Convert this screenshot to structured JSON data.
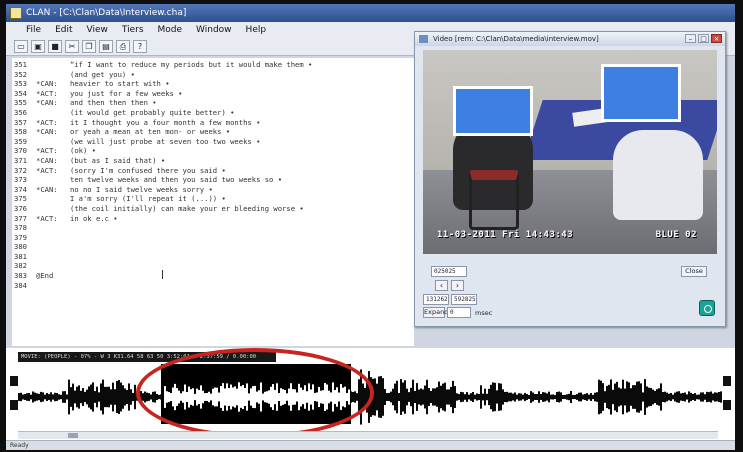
{
  "window": {
    "title": "CLAN - [C:\\Clan\\Data\\Interview.cha]"
  },
  "menu": [
    "File",
    "Edit",
    "View",
    "Tiers",
    "Mode",
    "Window",
    "Help"
  ],
  "toolbar_buttons": [
    "new",
    "open",
    "save",
    "cut",
    "copy",
    "paste",
    "print",
    "help"
  ],
  "transcript": [
    {
      "num": "351",
      "speaker": "",
      "text": "“if I want to reduce my periods but it would make them •"
    },
    {
      "num": "352",
      "speaker": "",
      "text": "(and get you) •"
    },
    {
      "num": "353",
      "speaker": "*CAN:",
      "text": "heavier to start with •"
    },
    {
      "num": "354",
      "speaker": "*ACT:",
      "text": "you just for a few weeks •"
    },
    {
      "num": "355",
      "speaker": "*CAN:",
      "text": "and then then then •"
    },
    {
      "num": "356",
      "speaker": "",
      "text": "(it would get probably quite better) •"
    },
    {
      "num": "357",
      "speaker": "*ACT:",
      "text": "it I thought you a four month a few months •"
    },
    {
      "num": "358",
      "speaker": "*CAN:",
      "text": "or yeah a mean at ten mon- or weeks •"
    },
    {
      "num": "359",
      "speaker": "",
      "text": "(we will just probe at seven too two weeks •"
    },
    {
      "num": "370",
      "speaker": "*ACT:",
      "text": "(ok) •"
    },
    {
      "num": "371",
      "speaker": "*CAN:",
      "text": "(but as I said that) •"
    },
    {
      "num": "372",
      "speaker": "*ACT:",
      "text": "(sorry I'm confused there you said •"
    },
    {
      "num": "373",
      "speaker": "",
      "text": "ten twelve weeks and then you said two weeks so •"
    },
    {
      "num": "374",
      "speaker": "*CAN:",
      "text": "no no I said twelve weeks sorry •"
    },
    {
      "num": "375",
      "speaker": "",
      "text": "I a'm sorry (I'll repeat it (...)) •"
    },
    {
      "num": "376",
      "speaker": "",
      "text": "(the coil initially) can make your er bleeding worse •"
    },
    {
      "num": "377",
      "speaker": "*ACT:",
      "text": "in ok e.c •"
    },
    {
      "num": "378",
      "speaker": "",
      "text": ""
    },
    {
      "num": "379",
      "speaker": "",
      "text": ""
    },
    {
      "num": "380",
      "speaker": "",
      "text": ""
    },
    {
      "num": "381",
      "speaker": "",
      "text": ""
    },
    {
      "num": "382",
      "speaker": "",
      "text": ""
    },
    {
      "num": "383",
      "speaker": "@End",
      "text": ""
    },
    {
      "num": "384",
      "speaker": "",
      "text": ""
    }
  ],
  "video_window": {
    "title": "Video [rem: C:\\Clan\\Data\\media\\interview.mov]",
    "timestamp": "11-03-2011 Fri 14:43:43",
    "camera": "BLUE 02",
    "time_field": "025025",
    "start_field": "131262",
    "end_field": "592825",
    "close_label": "Close",
    "expand_label": "Expand",
    "expand_value": "0",
    "unit_label": "msec",
    "colors": {
      "redaction": "#3e7fe2",
      "table": "#3b4aa0"
    }
  },
  "wave_panel": {
    "header_text": "MOVIE: (PEOPLE) - 07% - W 3 K31.64 58 63 50 3:52:01 / 2:37:59 / 0.00:00",
    "highlight_color": "#c6261f"
  },
  "status": {
    "text": "Ready"
  }
}
